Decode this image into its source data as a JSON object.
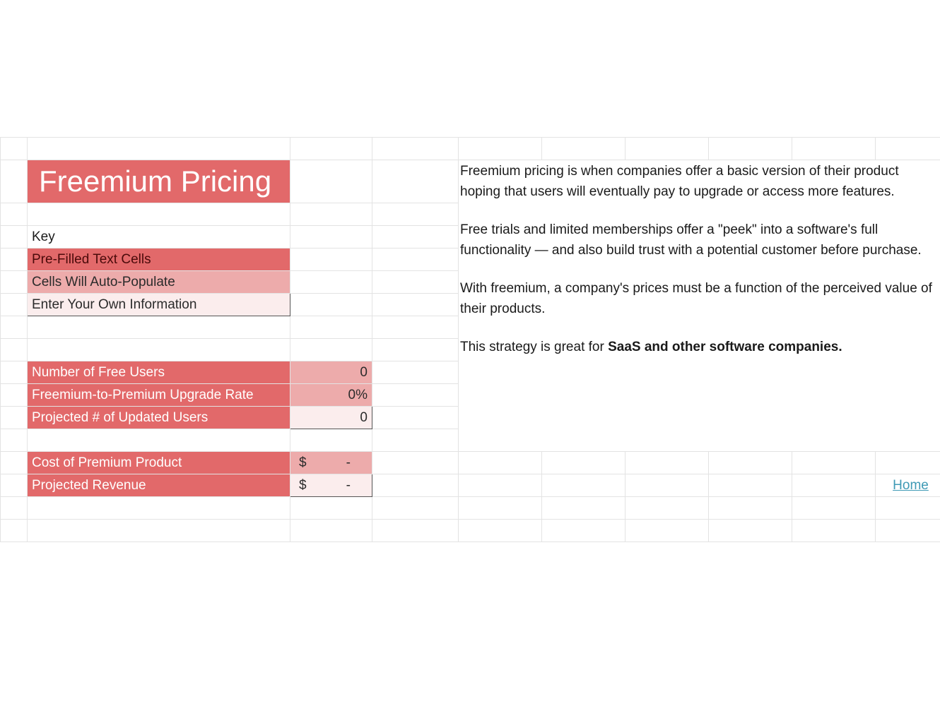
{
  "title": "Freemium Pricing",
  "key": {
    "heading": "Key",
    "prefilled": "Pre-Filled Text Cells",
    "auto": "Cells Will Auto-Populate",
    "enter": "Enter Your Own Information"
  },
  "rows": {
    "num_free_users": {
      "label": "Number of Free Users",
      "value": "0"
    },
    "upgrade_rate": {
      "label": "Freemium-to-Premium Upgrade Rate",
      "value": "0%"
    },
    "projected_users": {
      "label": "Projected # of Updated Users",
      "value": "0"
    },
    "cost_premium": {
      "label": "Cost of Premium Product",
      "symbol": "$",
      "value": "-"
    },
    "projected_rev": {
      "label": "Projected Revenue",
      "symbol": "$",
      "value": "-"
    }
  },
  "description": {
    "p1": "Freemium pricing is when companies offer a basic version of their product hoping that users will eventually pay to upgrade or access more features.",
    "p2a": "Free trials and limited memberships offer a \"peek\" into a software's full functionality — and also build trust with a potential customer before purchase.",
    "p3": "With freemium, a company's prices must be a function of the perceived value of their products.",
    "p4a": "This strategy is great for ",
    "p4b": "SaaS and other software companies."
  },
  "link": {
    "home": "Home"
  }
}
